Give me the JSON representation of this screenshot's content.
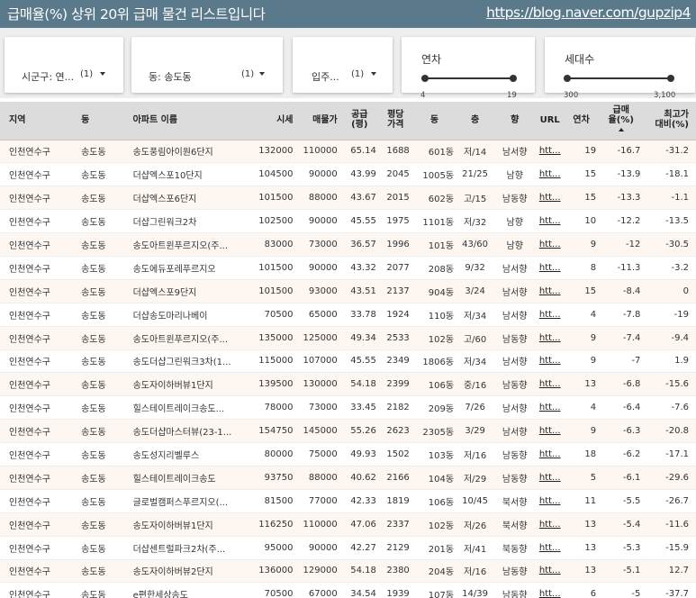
{
  "header": {
    "title": "급매율(%) 상위 20위 급매 물건 리스트입니다",
    "link": "https://blog.naver.com/gupzip4"
  },
  "filters": {
    "sigungu": {
      "label": "시군구: 연...",
      "count": "(1)"
    },
    "dong": {
      "label": "동: 송도동",
      "count": "(1)"
    },
    "ipju": {
      "label": "입주...",
      "count": "(1)"
    },
    "year": {
      "label": "연차",
      "min": "4",
      "max": "19"
    },
    "households": {
      "label": "세대수",
      "min": "300",
      "max": "3,100"
    }
  },
  "table": {
    "headers": {
      "region": "지역",
      "dong": "동",
      "apt": "아파트 이름",
      "price": "시세",
      "sale": "매물가",
      "supply": [
        "공급",
        "(평)"
      ],
      "per": [
        "평당",
        "가격"
      ],
      "building": "동",
      "floor": "층",
      "direction": "향",
      "url": "URL",
      "year": "연차",
      "rate": [
        "급매",
        "율(%)"
      ],
      "peak": [
        "최고가",
        "대비(%)"
      ]
    },
    "sort_icon": "sort-ascending-icon",
    "rows": [
      [
        "인천연수구",
        "송도동",
        "송도풍림아이원6단지",
        "132000",
        "110000",
        "65.14",
        "1688",
        "601동",
        "저/14",
        "남서향",
        "htt...",
        "19",
        "-16.7",
        "-31.2"
      ],
      [
        "인천연수구",
        "송도동",
        "더샵엑스포10단지",
        "104500",
        "90000",
        "43.99",
        "2045",
        "1005동",
        "21/25",
        "남향",
        "htt...",
        "15",
        "-13.9",
        "-18.1"
      ],
      [
        "인천연수구",
        "송도동",
        "더샵엑스포6단지",
        "101500",
        "88000",
        "43.67",
        "2015",
        "602동",
        "고/15",
        "남동향",
        "htt...",
        "15",
        "-13.3",
        "-1.1"
      ],
      [
        "인천연수구",
        "송도동",
        "더샵그린워크2차",
        "102500",
        "90000",
        "45.55",
        "1975",
        "1101동",
        "저/32",
        "남향",
        "htt...",
        "10",
        "-12.2",
        "-13.5"
      ],
      [
        "인천연수구",
        "송도동",
        "송도아트윈푸르지오(주...",
        "83000",
        "73000",
        "36.57",
        "1996",
        "101동",
        "43/60",
        "남향",
        "htt...",
        "9",
        "-12",
        "-30.5"
      ],
      [
        "인천연수구",
        "송도동",
        "송도에듀포레푸르지오",
        "101500",
        "90000",
        "43.32",
        "2077",
        "208동",
        "9/32",
        "남서향",
        "htt...",
        "8",
        "-11.3",
        "-3.2"
      ],
      [
        "인천연수구",
        "송도동",
        "더샵엑스포9단지",
        "101500",
        "93000",
        "43.51",
        "2137",
        "904동",
        "3/24",
        "남서향",
        "htt...",
        "15",
        "-8.4",
        "0"
      ],
      [
        "인천연수구",
        "송도동",
        "더샵송도마리나베이",
        "70500",
        "65000",
        "33.78",
        "1924",
        "110동",
        "저/34",
        "남서향",
        "htt...",
        "4",
        "-7.8",
        "-19"
      ],
      [
        "인천연수구",
        "송도동",
        "송도아트윈푸르지오(주...",
        "135000",
        "125000",
        "49.34",
        "2533",
        "102동",
        "고/60",
        "남동향",
        "htt...",
        "9",
        "-7.4",
        "-9.4"
      ],
      [
        "인천연수구",
        "송도동",
        "송도더샵그린워크3차(1...",
        "115000",
        "107000",
        "45.55",
        "2349",
        "1806동",
        "저/34",
        "남서향",
        "htt...",
        "9",
        "-7",
        "1.9"
      ],
      [
        "인천연수구",
        "송도동",
        "송도자이하버뷰1단지",
        "139500",
        "130000",
        "54.18",
        "2399",
        "106동",
        "중/16",
        "남동향",
        "htt...",
        "13",
        "-6.8",
        "-15.6"
      ],
      [
        "인천연수구",
        "송도동",
        "힐스테이트레이크송도...",
        "78000",
        "73000",
        "33.45",
        "2182",
        "209동",
        "7/26",
        "남서향",
        "htt...",
        "4",
        "-6.4",
        "-7.6"
      ],
      [
        "인천연수구",
        "송도동",
        "송도더샵마스터뷰(23-1...",
        "154750",
        "145000",
        "55.26",
        "2623",
        "2305동",
        "3/29",
        "남서향",
        "htt...",
        "9",
        "-6.3",
        "-20.8"
      ],
      [
        "인천연수구",
        "송도동",
        "송도성지리벨루스",
        "80000",
        "75000",
        "49.93",
        "1502",
        "103동",
        "저/16",
        "남동향",
        "htt...",
        "18",
        "-6.2",
        "-17.1"
      ],
      [
        "인천연수구",
        "송도동",
        "힐스테이트레이크송도",
        "93750",
        "88000",
        "40.62",
        "2166",
        "104동",
        "저/29",
        "남동향",
        "htt...",
        "5",
        "-6.1",
        "-29.6"
      ],
      [
        "인천연수구",
        "송도동",
        "글로벌캠퍼스푸르지오(...",
        "81500",
        "77000",
        "42.33",
        "1819",
        "106동",
        "10/45",
        "북서향",
        "htt...",
        "11",
        "-5.5",
        "-26.7"
      ],
      [
        "인천연수구",
        "송도동",
        "송도자이하버뷰1단지",
        "116250",
        "110000",
        "47.06",
        "2337",
        "102동",
        "저/26",
        "북서향",
        "htt...",
        "13",
        "-5.4",
        "-11.6"
      ],
      [
        "인천연수구",
        "송도동",
        "더샵센트럴파크2차(주...",
        "95000",
        "90000",
        "42.27",
        "2129",
        "201동",
        "저/41",
        "북동향",
        "htt...",
        "13",
        "-5.3",
        "-15.9"
      ],
      [
        "인천연수구",
        "송도동",
        "송도자이하버뷰2단지",
        "136000",
        "129000",
        "54.18",
        "2380",
        "204동",
        "저/16",
        "남동향",
        "htt...",
        "13",
        "-5.1",
        "12.7"
      ],
      [
        "인천연수구",
        "송도동",
        "e편한세상송도",
        "70500",
        "67000",
        "34.54",
        "1939",
        "107동",
        "14/39",
        "남동향",
        "htt...",
        "6",
        "-5",
        "-37.7"
      ]
    ]
  }
}
